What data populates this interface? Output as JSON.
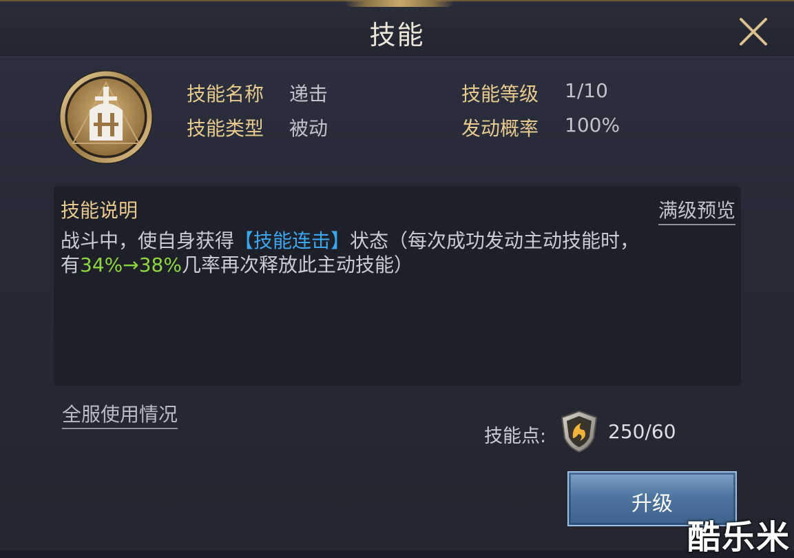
{
  "window": {
    "title": "技能"
  },
  "skill": {
    "icon": "knight-helmet-sword-icon",
    "rows": [
      {
        "label": "技能名称",
        "value": "递击"
      },
      {
        "label": "技能类型",
        "value": "被动"
      },
      {
        "label": "技能等级",
        "value": "1/10"
      },
      {
        "label": "发动概率",
        "value": "100%"
      }
    ]
  },
  "description": {
    "title": "技能说明",
    "preview_link": "满级预览",
    "line1_a": "战斗中，使自身获得",
    "line1_highlight": "【技能连击】",
    "line1_b": "状态（每次成功发动主动技能时，",
    "line2_a": "有",
    "line2_highlight": "34%→38%",
    "line2_b": "几率再次释放此主动技能）"
  },
  "usage_link": "全服使用情况",
  "skill_points": {
    "label": "技能点:",
    "icon": "shield-emblem-icon",
    "value": "250/60"
  },
  "upgrade_button": "升级",
  "watermark": "酷乐米",
  "colors": {
    "gold_label": "#e8c98e",
    "highlight_blue": "#3da6f0",
    "highlight_green": "#8ed83e",
    "button_blue": "#4f769f"
  }
}
